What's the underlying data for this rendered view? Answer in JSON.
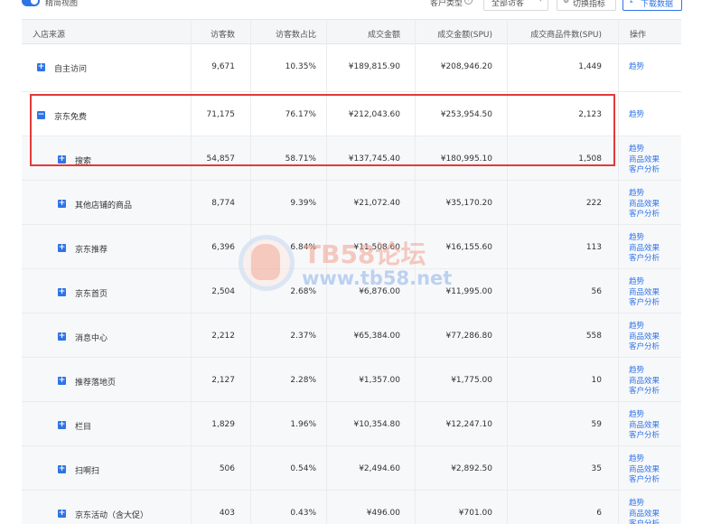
{
  "toolbar": {
    "view_toggle_label": "精简视图",
    "customer_type_label": "客户类型",
    "customer_type_value": "全部访客",
    "switch_metrics_label": "切换指标",
    "download_label": "下载数据"
  },
  "headers": [
    "入店来源",
    "访客数",
    "访客数占比",
    "成交金额",
    "成交金额(SPU)",
    "成交商品件数(SPU)",
    "操作"
  ],
  "ops": {
    "trend": "趋势",
    "product_effect": "商品效果",
    "customer_analysis": "客户分析"
  },
  "rows": [
    {
      "source": "自主访问",
      "visitors": "9,671",
      "ratio": "10.35%",
      "amount": "¥189,815.90",
      "amount_spu": "¥208,946.20",
      "qty_spu": "1,449",
      "level": 0,
      "expanded": false
    },
    {
      "source": "京东免费",
      "visitors": "71,175",
      "ratio": "76.17%",
      "amount": "¥212,043.60",
      "amount_spu": "¥253,954.50",
      "qty_spu": "2,123",
      "level": 0,
      "expanded": true
    },
    {
      "source": "搜索",
      "visitors": "54,857",
      "ratio": "58.71%",
      "amount": "¥137,745.40",
      "amount_spu": "¥180,995.10",
      "qty_spu": "1,508",
      "level": 1,
      "expanded": false
    },
    {
      "source": "其他店铺的商品",
      "visitors": "8,774",
      "ratio": "9.39%",
      "amount": "¥21,072.40",
      "amount_spu": "¥35,170.20",
      "qty_spu": "222",
      "level": 1,
      "expanded": false
    },
    {
      "source": "京东推荐",
      "visitors": "6,396",
      "ratio": "6.84%",
      "amount": "¥11,508.60",
      "amount_spu": "¥16,155.60",
      "qty_spu": "113",
      "level": 1,
      "expanded": false
    },
    {
      "source": "京东首页",
      "visitors": "2,504",
      "ratio": "2.68%",
      "amount": "¥6,876.00",
      "amount_spu": "¥11,995.00",
      "qty_spu": "56",
      "level": 1,
      "expanded": false
    },
    {
      "source": "消息中心",
      "visitors": "2,212",
      "ratio": "2.37%",
      "amount": "¥65,384.00",
      "amount_spu": "¥77,286.80",
      "qty_spu": "558",
      "level": 1,
      "expanded": false
    },
    {
      "source": "推荐落地页",
      "visitors": "2,127",
      "ratio": "2.28%",
      "amount": "¥1,357.00",
      "amount_spu": "¥1,775.00",
      "qty_spu": "10",
      "level": 1,
      "expanded": false
    },
    {
      "source": "栏目",
      "visitors": "1,829",
      "ratio": "1.96%",
      "amount": "¥10,354.80",
      "amount_spu": "¥12,247.10",
      "qty_spu": "59",
      "level": 1,
      "expanded": false
    },
    {
      "source": "扫啊扫",
      "visitors": "506",
      "ratio": "0.54%",
      "amount": "¥2,494.60",
      "amount_spu": "¥2,892.50",
      "qty_spu": "35",
      "level": 1,
      "expanded": false
    },
    {
      "source": "京东活动（含大促）",
      "visitors": "403",
      "ratio": "0.43%",
      "amount": "¥496.00",
      "amount_spu": "¥701.00",
      "qty_spu": "6",
      "level": 1,
      "expanded": false
    }
  ],
  "watermark": {
    "title": "TB58论坛",
    "url": "www.tb58.net"
  },
  "colors": {
    "accent": "#2f74e6",
    "highlight": "#e23a3a"
  }
}
